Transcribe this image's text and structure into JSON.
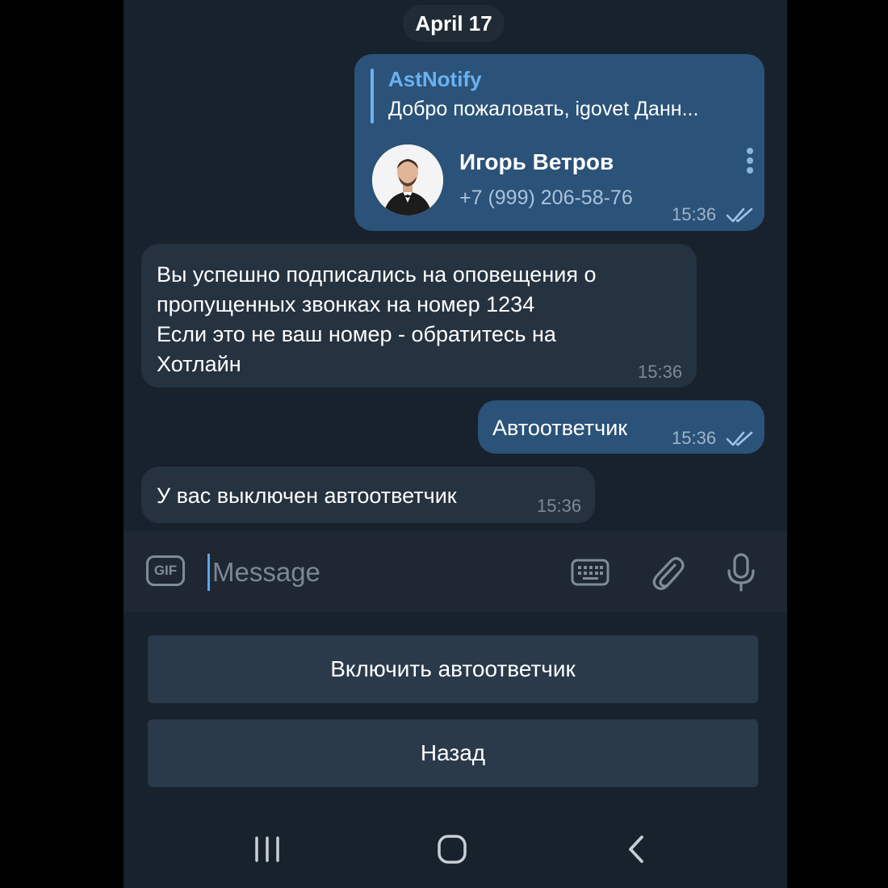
{
  "chat": {
    "date": "April 17",
    "messages": [
      {
        "direction": "outgoing",
        "reply": {
          "name": "AstNotify",
          "text": "Добро пожаловать, igovet  Данн..."
        },
        "contact": {
          "name": "Игорь Ветров",
          "phone": "+7 (999) 206-58-76"
        },
        "time": "15:36",
        "status": "read"
      },
      {
        "direction": "incoming",
        "lines": [
          "Вы успешно подписались на оповещения о",
          "пропущенных звонках на номер 1234",
          "Если это не ваш номер - обратитесь на",
          "Хотлайн"
        ],
        "time": "15:36"
      },
      {
        "direction": "outgoing",
        "text": "Автоответчик",
        "time": "15:36",
        "status": "read"
      },
      {
        "direction": "incoming",
        "text": "У вас выключен автоответчик",
        "time": "15:36"
      }
    ]
  },
  "composer": {
    "gif_label": "GIF",
    "placeholder": "Message",
    "icons": [
      "gif-icon",
      "keyboard-icon",
      "attach-icon",
      "microphone-icon"
    ]
  },
  "bot_keyboard": {
    "buttons": [
      "Включить автоответчик",
      "Назад"
    ]
  },
  "navbar": {
    "icons": [
      "recent-apps-icon",
      "home-icon",
      "back-icon"
    ]
  },
  "colors": {
    "background": "#18222d",
    "outgoing_bubble": "#2b5278",
    "incoming_bubble": "#253240",
    "accent": "#6ab2f2",
    "keyboard_button": "#2a3a4b"
  }
}
